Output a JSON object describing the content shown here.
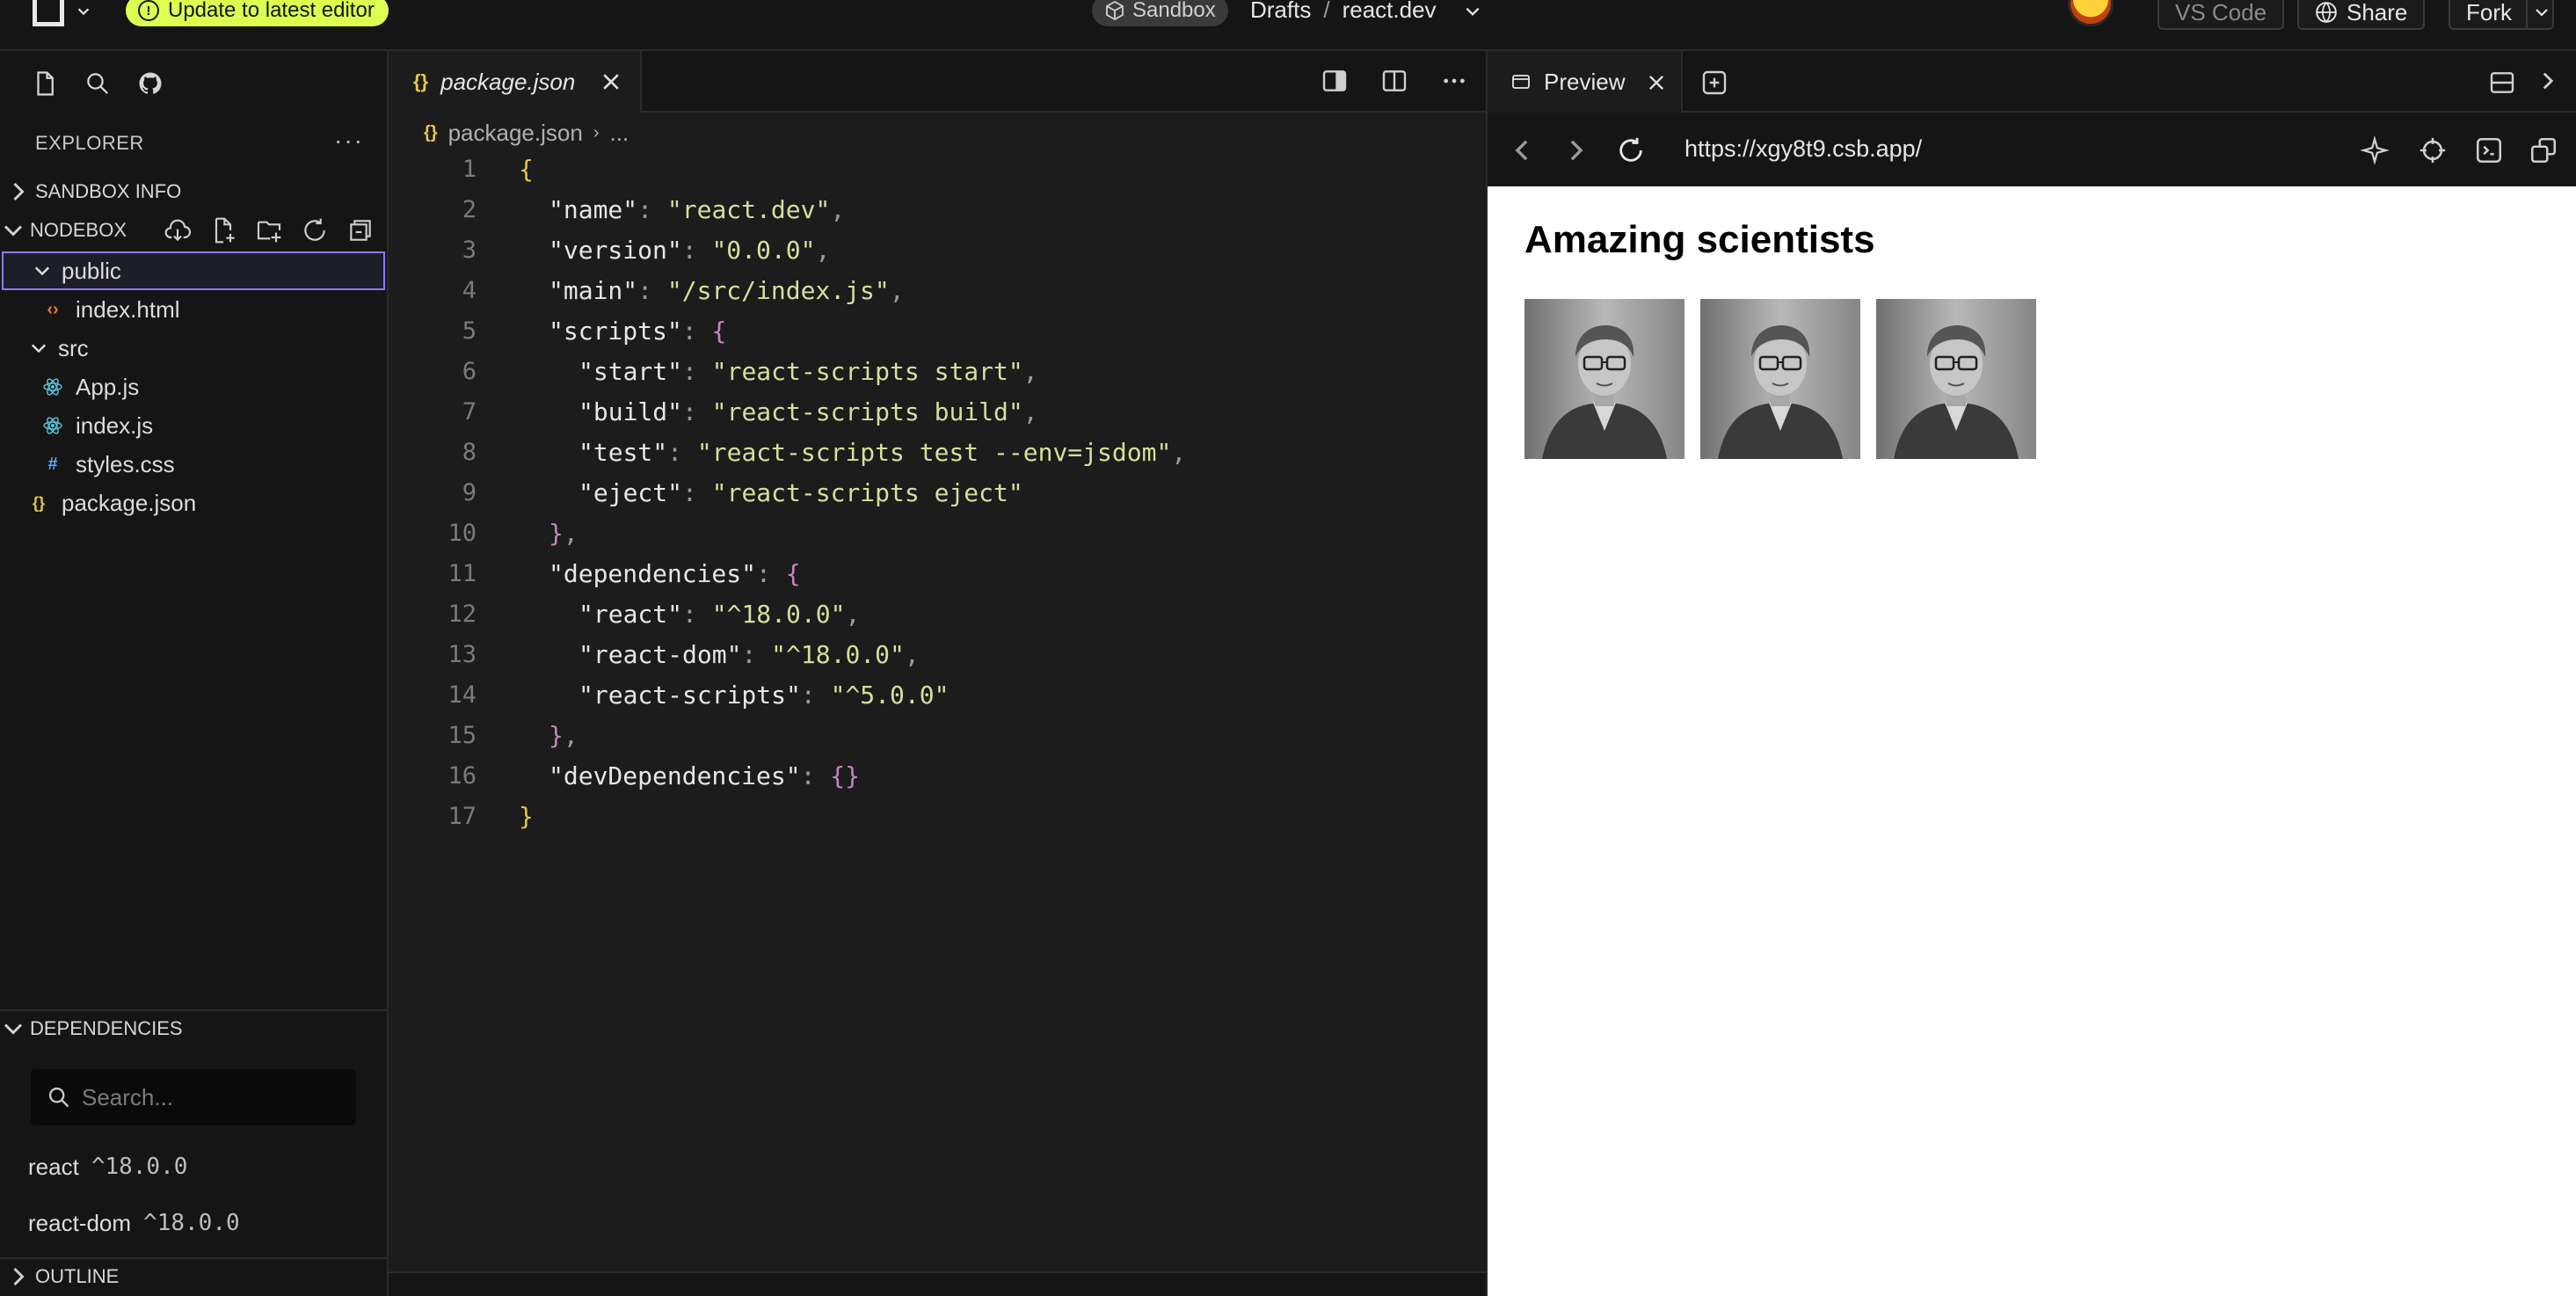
{
  "topbar": {
    "update_label": "Update to latest editor",
    "sandbox_label": "Sandbox",
    "breadcrumb": [
      "Drafts",
      "/",
      "react.dev"
    ],
    "vscode_label": "VS Code",
    "share_label": "Share",
    "fork_label": "Fork"
  },
  "sidebar": {
    "explorer_title": "EXPLORER",
    "more": "···",
    "sandbox_info": "SANDBOX INFO",
    "nodebox": "NODEBOX",
    "tree": [
      {
        "label": "public",
        "type": "folder",
        "depth": 0,
        "expanded": true
      },
      {
        "label": "index.html",
        "type": "html",
        "depth": 1
      },
      {
        "label": "src",
        "type": "folder",
        "depth": 0,
        "expanded": true
      },
      {
        "label": "App.js",
        "type": "react",
        "depth": 1
      },
      {
        "label": "index.js",
        "type": "react",
        "depth": 1
      },
      {
        "label": "styles.css",
        "type": "css",
        "depth": 1
      },
      {
        "label": "package.json",
        "type": "json",
        "depth": 0
      }
    ],
    "dependencies_title": "DEPENDENCIES",
    "search_placeholder": "Search...",
    "dependencies": [
      {
        "name": "react",
        "version": "^18.0.0"
      },
      {
        "name": "react-dom",
        "version": "^18.0.0"
      }
    ],
    "outline_title": "OUTLINE"
  },
  "editor": {
    "tab_label": "package.json",
    "tab_icon": "{}",
    "breadcrumb_file": "package.json",
    "breadcrumb_rest": "...",
    "lines": [
      {
        "n": "1",
        "indent": 0,
        "tokens": [
          [
            "p",
            "{"
          ]
        ]
      },
      {
        "n": "2",
        "indent": 1,
        "tokens": [
          [
            "k",
            "\"name\""
          ],
          [
            "c",
            ": "
          ],
          [
            "s",
            "\"react.dev\""
          ],
          [
            "c",
            ","
          ]
        ]
      },
      {
        "n": "3",
        "indent": 1,
        "tokens": [
          [
            "k",
            "\"version\""
          ],
          [
            "c",
            ": "
          ],
          [
            "s",
            "\"0.0.0\""
          ],
          [
            "c",
            ","
          ]
        ]
      },
      {
        "n": "4",
        "indent": 1,
        "tokens": [
          [
            "k",
            "\"main\""
          ],
          [
            "c",
            ": "
          ],
          [
            "s",
            "\"/src/index.js\""
          ],
          [
            "c",
            ","
          ]
        ]
      },
      {
        "n": "5",
        "indent": 1,
        "tokens": [
          [
            "k",
            "\"scripts\""
          ],
          [
            "c",
            ": "
          ],
          [
            "pb",
            "{"
          ]
        ]
      },
      {
        "n": "6",
        "indent": 2,
        "tokens": [
          [
            "k",
            "\"start\""
          ],
          [
            "c",
            ": "
          ],
          [
            "s",
            "\"react-scripts start\""
          ],
          [
            "c",
            ","
          ]
        ]
      },
      {
        "n": "7",
        "indent": 2,
        "tokens": [
          [
            "k",
            "\"build\""
          ],
          [
            "c",
            ": "
          ],
          [
            "s",
            "\"react-scripts build\""
          ],
          [
            "c",
            ","
          ]
        ]
      },
      {
        "n": "8",
        "indent": 2,
        "tokens": [
          [
            "k",
            "\"test\""
          ],
          [
            "c",
            ": "
          ],
          [
            "s",
            "\"react-scripts test --env=jsdom\""
          ],
          [
            "c",
            ","
          ]
        ]
      },
      {
        "n": "9",
        "indent": 2,
        "tokens": [
          [
            "k",
            "\"eject\""
          ],
          [
            "c",
            ": "
          ],
          [
            "s",
            "\"react-scripts eject\""
          ]
        ]
      },
      {
        "n": "10",
        "indent": 1,
        "tokens": [
          [
            "pb",
            "}"
          ],
          [
            "c",
            ","
          ]
        ]
      },
      {
        "n": "11",
        "indent": 1,
        "tokens": [
          [
            "k",
            "\"dependencies\""
          ],
          [
            "c",
            ": "
          ],
          [
            "pb",
            "{"
          ]
        ]
      },
      {
        "n": "12",
        "indent": 2,
        "tokens": [
          [
            "k",
            "\"react\""
          ],
          [
            "c",
            ": "
          ],
          [
            "s",
            "\"^18.0.0\""
          ],
          [
            "c",
            ","
          ]
        ]
      },
      {
        "n": "13",
        "indent": 2,
        "tokens": [
          [
            "k",
            "\"react-dom\""
          ],
          [
            "c",
            ": "
          ],
          [
            "s",
            "\"^18.0.0\""
          ],
          [
            "c",
            ","
          ]
        ]
      },
      {
        "n": "14",
        "indent": 2,
        "tokens": [
          [
            "k",
            "\"react-scripts\""
          ],
          [
            "c",
            ": "
          ],
          [
            "s",
            "\"^5.0.0\""
          ]
        ]
      },
      {
        "n": "15",
        "indent": 1,
        "tokens": [
          [
            "pb",
            "}"
          ],
          [
            "c",
            ","
          ]
        ]
      },
      {
        "n": "16",
        "indent": 1,
        "tokens": [
          [
            "k",
            "\"devDependencies\""
          ],
          [
            "c",
            ": "
          ],
          [
            "pb",
            "{}"
          ]
        ]
      },
      {
        "n": "17",
        "indent": 0,
        "tokens": [
          [
            "p",
            "}"
          ]
        ]
      }
    ]
  },
  "preview": {
    "tab_label": "Preview",
    "url": "https://xgy8t9.csb.app/",
    "heading": "Amazing scientists",
    "images": 3
  },
  "colors": {
    "accent_yellow": "#dcff50",
    "selection_border": "#8b7cf6",
    "json_brace": "#e7c547",
    "json_nested_brace": "#c586c0",
    "json_string": "#d6df9b"
  }
}
